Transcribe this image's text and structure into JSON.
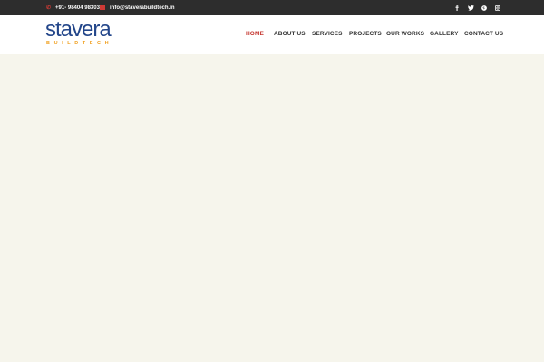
{
  "topbar": {
    "phone": "+91- 98404 98303",
    "email": "info@staverabuildtech.in",
    "socials": [
      "facebook-icon",
      "twitter-icon",
      "pinterest-icon",
      "instagram-icon"
    ]
  },
  "logo": {
    "wordmark": "stavera",
    "tagline": "BUILDTECH"
  },
  "nav": {
    "items": [
      "HOME",
      "ABOUT US",
      "SERVICES",
      "PROJECTS",
      "OUR WORKS",
      "GALLERY",
      "CONTACT US"
    ],
    "active": "HOME"
  },
  "colors": {
    "topbar": "#2d2d2d",
    "accent": "#c4342d",
    "logo_blue": "#23468a",
    "logo_orange": "#f0a020",
    "background": "#f6f5ec"
  }
}
